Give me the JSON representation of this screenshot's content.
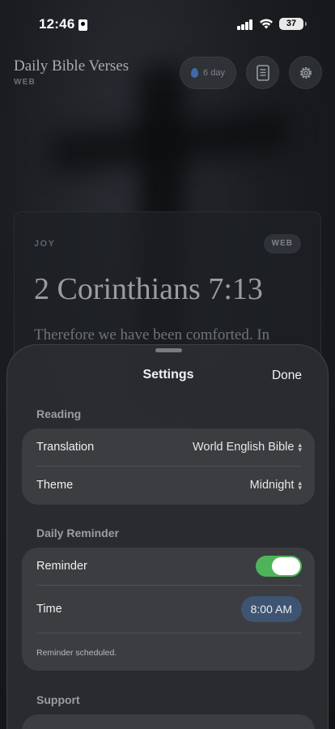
{
  "status_bar": {
    "time": "12:46",
    "battery": "37"
  },
  "header": {
    "title": "Daily Bible Verses",
    "subtitle": "WEB",
    "streak_label": "6 day",
    "streak_icon": "flame-icon",
    "colors": {
      "accent": "#3c6ca8"
    }
  },
  "card": {
    "tag": "JOY",
    "translation_chip": "WEB",
    "reference": "2 Corinthians 7:13",
    "verse_text": "Therefore we have been comforted. In"
  },
  "settings": {
    "title": "Settings",
    "done_label": "Done",
    "reading": {
      "heading": "Reading",
      "translation_label": "Translation",
      "translation_value": "World English Bible",
      "theme_label": "Theme",
      "theme_value": "Midnight"
    },
    "daily_reminder": {
      "heading": "Daily Reminder",
      "reminder_label": "Reminder",
      "reminder_enabled": true,
      "time_label": "Time",
      "time_value": "8:00 AM",
      "status_note": "Reminder scheduled."
    },
    "support": {
      "heading": "Support"
    },
    "colors": {
      "toggle_on": "#4fb35a",
      "time_pill": "#3e5472"
    }
  }
}
